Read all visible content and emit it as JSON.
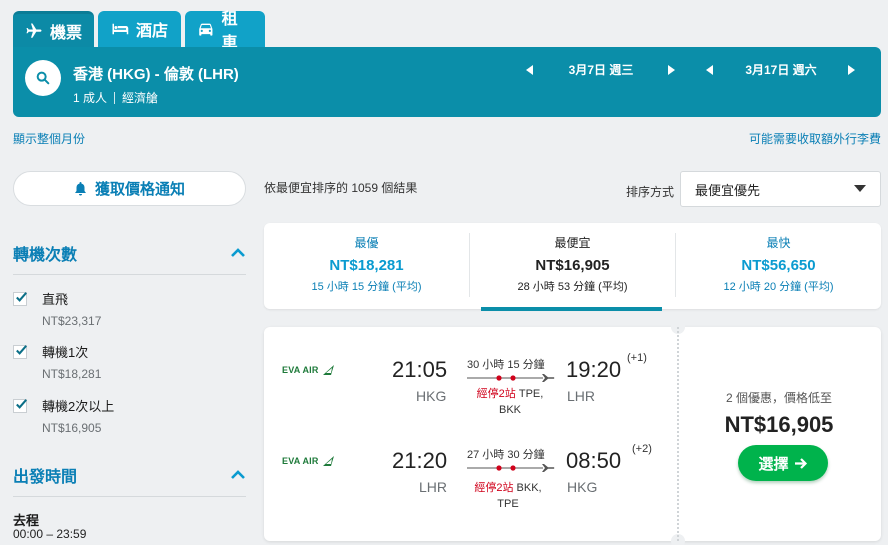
{
  "tabs": [
    {
      "label": "機票",
      "icon": "plane-icon"
    },
    {
      "label": "酒店",
      "icon": "bed-icon"
    },
    {
      "label": "租車",
      "icon": "car-icon"
    }
  ],
  "search": {
    "route": "香港 (HKG) - 倫敦 (LHR)",
    "passengers": "1 成人",
    "cabin": "經濟艙",
    "depart_date": "3月7日 週三",
    "return_date": "3月17日 週六"
  },
  "links": {
    "month_view": "顯示整個月份",
    "extra_fees": "可能需要收取額外行李費"
  },
  "sidebar": {
    "price_alert": "獲取價格通知",
    "stops_title": "轉機次數",
    "stop_options": [
      {
        "label": "直飛",
        "price": "NT$23,317"
      },
      {
        "label": "轉機1次",
        "price": "NT$18,281"
      },
      {
        "label": "轉機2次以上",
        "price": "NT$16,905"
      }
    ],
    "depart_title": "出發時間",
    "outbound_label": "去程",
    "outbound_range": "00:00 – 23:59"
  },
  "results": {
    "count_text": "依最便宜排序的 1059 個結果",
    "sort_label": "排序方式",
    "sort_value": "最便宜優先"
  },
  "summary": [
    {
      "label": "最優",
      "price": "NT$18,281",
      "duration": "15 小時 15 分鐘 (平均)"
    },
    {
      "label": "最便宜",
      "price": "NT$16,905",
      "duration": "28 小時 53 分鐘 (平均)"
    },
    {
      "label": "最快",
      "price": "NT$56,650",
      "duration": "12 小時 20 分鐘 (平均)"
    }
  ],
  "card": {
    "airline": "EVA AIR",
    "outbound": {
      "depart_time": "21:05",
      "depart_code": "HKG",
      "arrive_time": "19:20",
      "arrive_code": "LHR",
      "day_offset": "(+1)",
      "duration": "30 小時 15 分鐘",
      "stops_red": "經停2站",
      "stops_via": "TPE,",
      "stops_via2": "BKK"
    },
    "inbound": {
      "depart_time": "21:20",
      "depart_code": "LHR",
      "arrive_time": "08:50",
      "arrive_code": "HKG",
      "day_offset": "(+2)",
      "duration": "27 小時 30 分鐘",
      "stops_red": "經停2站",
      "stops_via": "BKK,",
      "stops_via2": "TPE"
    },
    "deals_text": "2 個優惠，價格低至",
    "price": "NT$16,905",
    "select_label": "選擇"
  },
  "colors": {
    "brand": "#0b8ea9",
    "link": "#0a7fb5",
    "select_green": "#00b34c",
    "stop_red": "#d0021b",
    "airline_green": "#1e7a3a"
  }
}
